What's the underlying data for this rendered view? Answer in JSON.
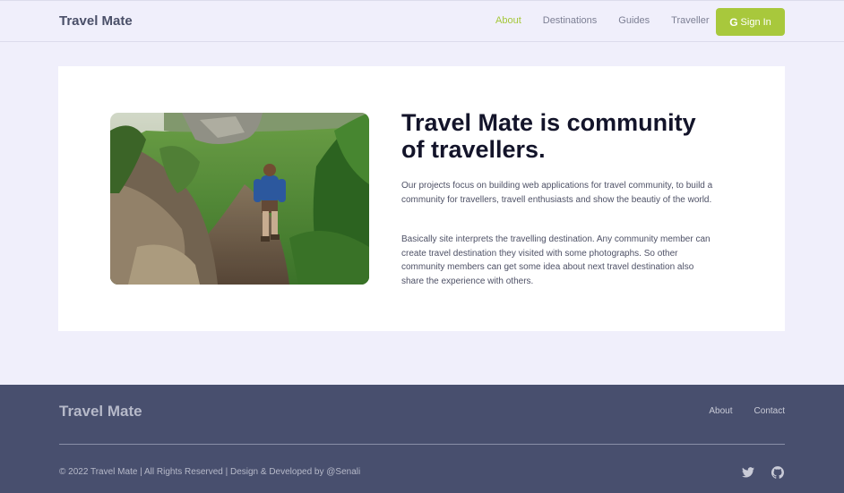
{
  "nav": {
    "brand": "Travel Mate",
    "links": [
      "About",
      "Destinations",
      "Guides",
      "Traveller"
    ],
    "active_index": 0,
    "signin_label": "Sign In",
    "signin_icon": "google-icon"
  },
  "main": {
    "headline": "Travel Mate is community of travellers.",
    "paragraph1": "Our projects focus on building web applications for travel community, to build a community for travellers, travell enthusiasts and show the beautiy of the world.",
    "paragraph2": "Basically site interprets the travelling destination. Any community member can create travel destination they visited with some photographs. So other community members can get some idea about next travel destination also share the experience with others.",
    "image": "hiker-on-mountain-trail"
  },
  "footer": {
    "brand": "Travel Mate",
    "links": [
      "About",
      "Contact"
    ],
    "copyright": "© 2022 Travel Mate | All Rights Reserved | Design & Developed by @Senali",
    "social_icons": [
      "twitter-icon",
      "github-icon"
    ]
  },
  "colors": {
    "accent": "#a8c83c",
    "background": "#f0effb",
    "footer_bg": "#484f6e",
    "text_dark": "#13142a"
  }
}
